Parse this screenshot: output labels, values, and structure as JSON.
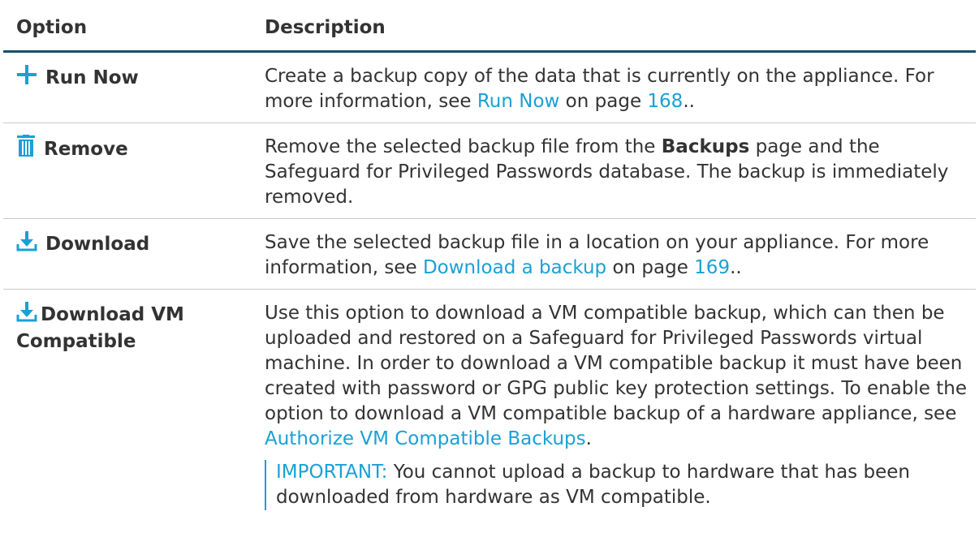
{
  "header": {
    "option": "Option",
    "description": "Description"
  },
  "colors": {
    "link": "#1aa0d6",
    "header_rule": "#17506e",
    "text": "#333333"
  },
  "rows": [
    {
      "icon": "plus-icon",
      "label": "Run Now",
      "desc": {
        "t1": "Create a backup copy of the data that is currently on the appliance. For more information, see ",
        "link1": "Run Now",
        "t2": " on page ",
        "link2": "168",
        "t3": ".."
      }
    },
    {
      "icon": "trash-icon",
      "label": "Remove",
      "desc": {
        "t1": "Remove the selected backup file from the ",
        "bold": "Backups",
        "t2": " page and the Safeguard for Privileged Passwords database. The backup is immediately removed."
      }
    },
    {
      "icon": "download-icon",
      "label": "Download",
      "desc": {
        "t1": "Save the selected backup file in a location on your appliance. For more information, see ",
        "link1": "Download a backup",
        "t2": " on page ",
        "link2": "169",
        "t3": ".."
      }
    },
    {
      "icon": "download-icon",
      "label": "Download VM Compatible",
      "desc": {
        "t1": "Use this option to download a VM compatible backup, which can then be uploaded and restored on a Safeguard for Privileged Passwords virtual machine. In order to download a VM compatible backup it must have been created with password or GPG public key protection settings. To enable the option to download a VM compatible backup of a hardware appliance, see ",
        "link1": "Authorize VM Compatible Backups",
        "t2": ".",
        "note_label": "IMPORTANT:",
        "note_text": " You cannot upload a backup to hardware that has been downloaded from hardware as VM compatible."
      }
    }
  ]
}
